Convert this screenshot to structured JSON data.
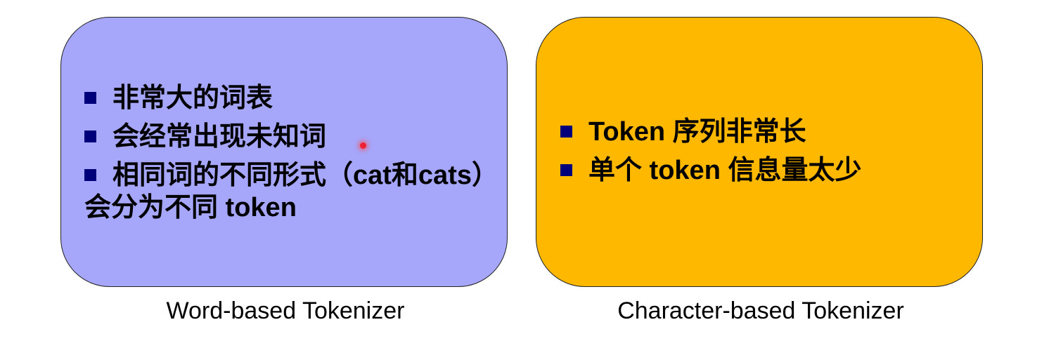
{
  "word_box": {
    "items": [
      "非常大的词表",
      "会经常出现未知词",
      "相同词的不同形式（cat和cats）会分为不同 token"
    ],
    "caption": "Word-based Tokenizer",
    "color": "#a6a6fa"
  },
  "char_box": {
    "items": [
      "Token 序列非常长",
      "单个 token 信息量太少"
    ],
    "caption": "Character-based Tokenizer",
    "color": "#ffb800"
  },
  "bullet_color": "#00007a"
}
